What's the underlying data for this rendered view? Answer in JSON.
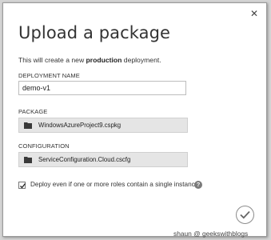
{
  "dialog": {
    "title": "Upload a package",
    "subtitle_prefix": "This will create a new ",
    "subtitle_bold": "production",
    "subtitle_suffix": " deployment.",
    "close_icon": "close-icon"
  },
  "deployment_name": {
    "label": "DEPLOYMENT NAME",
    "value": "demo-v1"
  },
  "package": {
    "label": "PACKAGE",
    "file_name": "WindowsAzureProject9.cspkg",
    "icon": "folder-icon"
  },
  "configuration": {
    "label": "CONFIGURATION",
    "file_name": "ServiceConfiguration.Cloud.cscfg",
    "icon": "folder-icon"
  },
  "deploy_option": {
    "label": "Deploy even if one or more roles contain a single instance",
    "checked": true,
    "help_glyph": "?"
  },
  "confirm": {
    "icon": "checkmark-icon"
  },
  "watermark": "shaun @ geekswithblogs",
  "colors": {
    "file_box_bg": "#e5e5e5",
    "frame_bg": "#ffffff",
    "page_bg": "#d4d4d4"
  }
}
